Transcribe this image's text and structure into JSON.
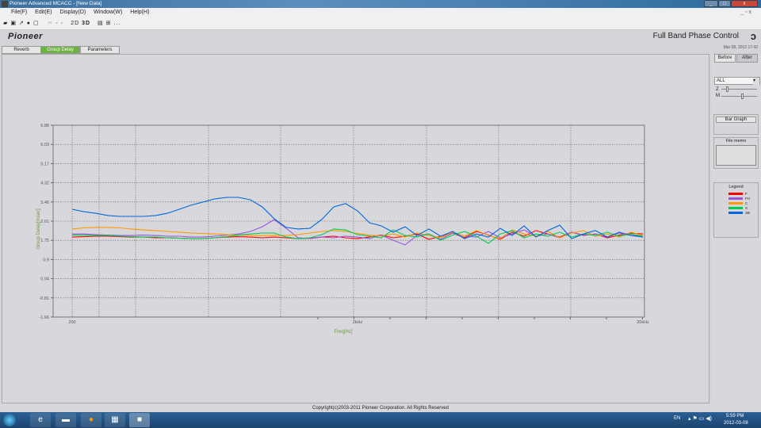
{
  "window": {
    "title": "Pioneer Advanced MCACC - [New Data]"
  },
  "menu": [
    "File(F)",
    "Edit(E)",
    "Display(D)",
    "Window(W)",
    "Help(H)"
  ],
  "toolbar": {
    "icons": [
      "open-icon",
      "save-icon",
      "graph-icon",
      "print-icon",
      "preview-icon",
      "cut-icon",
      "copy-icon",
      "paste-icon"
    ],
    "btn_2d": "2D",
    "btn_3d": "3D",
    "more": "..."
  },
  "header": {
    "brand": "Pioneer",
    "product": "Full Band Phase Control",
    "date": "Mar 08, 2012 17:42"
  },
  "tabs": [
    {
      "label": "Reverb"
    },
    {
      "label": "Group Delay",
      "active": true
    },
    {
      "label": "Parameters"
    }
  ],
  "right": {
    "before": "Before",
    "after": "After",
    "channel_select": "ALL",
    "z_label": "Z",
    "m_label": "M",
    "z_level": 0.15,
    "m_level": 0.6,
    "bar_graph": "Bar Graph",
    "file_memo": "File memo",
    "legend_title": "Legend"
  },
  "footer": {
    "copyright": "Copyright(c)2003-2011 Pioneer Corporation. All Rights Reserved"
  },
  "taskbar": {
    "lang": "EN",
    "time": "5:59 PM",
    "date": "2012-03-08"
  },
  "chart_data": {
    "type": "line",
    "xlabel": "Freq[Hz]",
    "ylabel": "Group Delay[msec]",
    "xscale": "log",
    "xlim": [
      200,
      20000
    ],
    "xticks": [
      {
        "v": 200,
        "label": "200"
      },
      {
        "v": 2000,
        "label": "2kHz"
      },
      {
        "v": 20000,
        "label": "20kHz"
      }
    ],
    "ylim": [
      -1.66,
      6.88
    ],
    "yticks": [
      "6.88",
      "6.03",
      "5.17",
      "4.32",
      "3.46",
      "2.61",
      "1.75",
      "0.9",
      "0.04",
      "-0.81",
      "-1.66"
    ],
    "grid": true,
    "legend": "right-panel",
    "x": [
      200,
      220,
      242,
      267,
      294,
      323,
      356,
      392,
      431,
      475,
      522,
      575,
      632,
      696,
      766,
      843,
      928,
      1021,
      1125,
      1238,
      1362,
      1499,
      1650,
      1817,
      2000,
      2201,
      2423,
      2667,
      2936,
      3232,
      3557,
      3915,
      4310,
      4744,
      5222,
      5748,
      6327,
      6964,
      7666,
      8438,
      9288,
      10224,
      11254,
      12388,
      13636,
      15010,
      16522,
      18186,
      20000
    ],
    "series": [
      {
        "name": "F",
        "color": "#ff0000",
        "values": [
          1.9,
          1.92,
          1.94,
          1.94,
          1.92,
          1.9,
          1.9,
          1.87,
          1.87,
          1.85,
          1.83,
          1.83,
          1.87,
          1.9,
          1.92,
          1.9,
          1.87,
          1.9,
          1.87,
          1.83,
          1.85,
          1.9,
          1.94,
          1.87,
          1.83,
          1.9,
          1.99,
          1.87,
          1.94,
          2.04,
          1.8,
          1.94,
          2.08,
          1.87,
          2.15,
          1.99,
          1.8,
          2.12,
          1.94,
          2.19,
          2.04,
          1.9,
          2.12,
          1.97,
          2.04,
          1.87,
          1.99,
          2.08,
          2.04
        ]
      },
      {
        "name": "FH",
        "color": "#9955dd",
        "values": [
          2.04,
          2.04,
          2.01,
          1.99,
          1.97,
          1.97,
          1.99,
          1.97,
          1.94,
          1.94,
          1.9,
          1.9,
          1.94,
          1.99,
          2.04,
          2.15,
          2.36,
          2.68,
          2.29,
          1.87,
          1.83,
          1.9,
          1.87,
          1.94,
          1.9,
          1.83,
          1.99,
          1.76,
          1.55,
          1.97,
          2.04,
          1.8,
          2.08,
          1.94,
          1.9,
          2.15,
          1.87,
          2.04,
          2.22,
          1.94,
          2.04,
          1.87,
          2.12,
          1.99,
          2.04,
          1.9,
          2.08,
          1.97,
          1.94
        ]
      },
      {
        "name": "C",
        "color": "#ff9900",
        "values": [
          2.26,
          2.31,
          2.33,
          2.33,
          2.31,
          2.26,
          2.22,
          2.19,
          2.15,
          2.12,
          2.08,
          2.06,
          2.04,
          2.01,
          1.99,
          1.97,
          1.97,
          1.97,
          1.97,
          2.01,
          2.08,
          2.15,
          2.19,
          2.15,
          2.06,
          1.99,
          1.94,
          2.04,
          1.9,
          2.08,
          1.97,
          1.87,
          2.12,
          1.94,
          2.19,
          1.97,
          1.83,
          2.22,
          2.04,
          1.94,
          2.15,
          1.87,
          2.08,
          2.19,
          1.94,
          2.04,
          1.9,
          2.12,
          1.97
        ]
      },
      {
        "name": "S",
        "color": "#00cc55",
        "values": [
          1.99,
          1.99,
          1.97,
          1.97,
          1.94,
          1.92,
          1.9,
          1.9,
          1.87,
          1.85,
          1.83,
          1.83,
          1.87,
          1.92,
          1.99,
          2.04,
          2.08,
          2.08,
          1.9,
          1.83,
          1.87,
          2.01,
          2.26,
          2.22,
          2.01,
          1.94,
          1.87,
          2.22,
          1.97,
          1.9,
          2.04,
          1.76,
          1.99,
          2.15,
          1.94,
          1.62,
          2.04,
          2.19,
          1.87,
          2.04,
          1.94,
          2.12,
          1.9,
          2.04,
          1.97,
          2.12,
          1.94,
          2.04,
          1.94
        ]
      },
      {
        "name": "SB",
        "color": "#0066dd",
        "values": [
          3.14,
          3.03,
          2.96,
          2.86,
          2.82,
          2.82,
          2.82,
          2.86,
          2.96,
          3.14,
          3.32,
          3.46,
          3.6,
          3.67,
          3.67,
          3.56,
          3.24,
          2.72,
          2.33,
          2.26,
          2.29,
          2.68,
          3.24,
          3.39,
          3.07,
          2.54,
          2.4,
          2.12,
          2.36,
          1.97,
          2.26,
          1.94,
          2.15,
          1.83,
          2.04,
          1.9,
          2.29,
          1.97,
          2.4,
          1.9,
          2.19,
          2.43,
          1.83,
          2.04,
          2.19,
          1.9,
          2.12,
          1.97,
          1.9
        ]
      }
    ]
  }
}
